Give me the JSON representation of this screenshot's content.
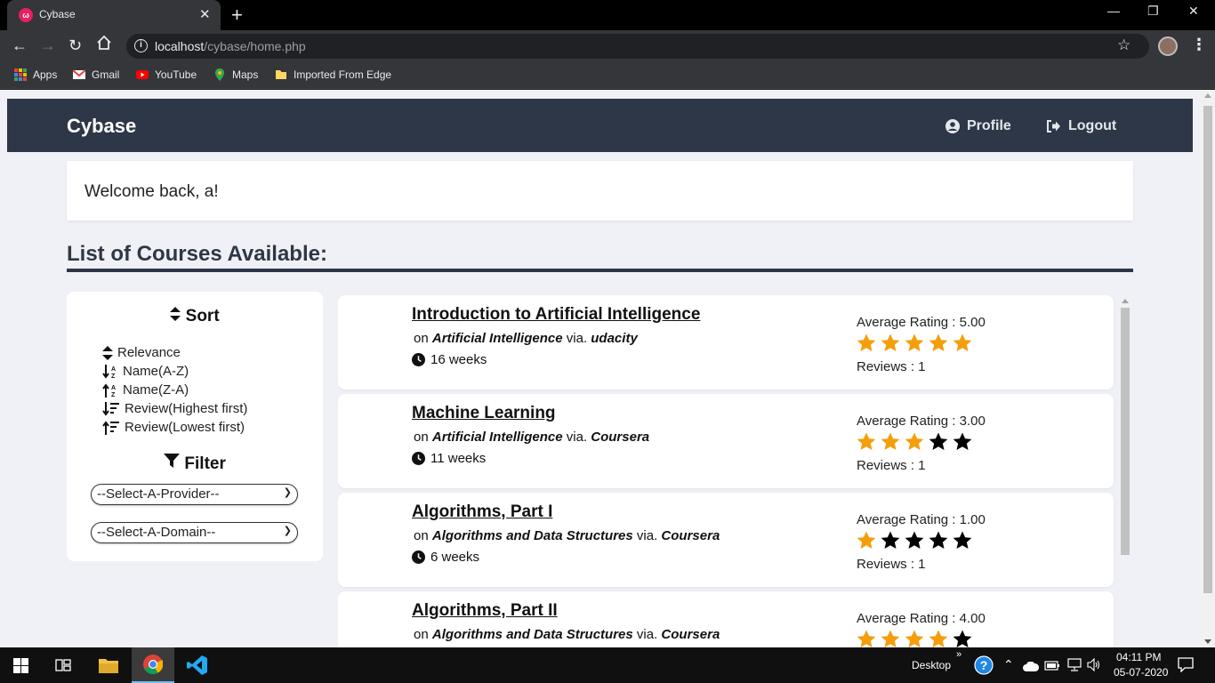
{
  "browser": {
    "tab_title": "Cybase",
    "tab_icon_letter": "ω",
    "url_host": "localhost",
    "url_path": "/cybase/home.php",
    "bookmarks": [
      "Apps",
      "Gmail",
      "YouTube",
      "Maps",
      "Imported From Edge"
    ]
  },
  "navbar": {
    "brand": "Cybase",
    "profile_label": "Profile",
    "logout_label": "Logout"
  },
  "welcome": "Welcome back, a!",
  "list_heading": "List of Courses Available:",
  "sidebar": {
    "sort_title": "Sort",
    "sort_options": [
      "Relevance",
      "Name(A-Z)",
      "Name(Z-A)",
      "Review(Highest first)",
      "Review(Lowest first)"
    ],
    "filter_title": "Filter",
    "provider_select": "--Select-A-Provider--",
    "domain_select": "--Select-A-Domain--"
  },
  "courses": [
    {
      "title": "Introduction to Artificial Intelligence",
      "on": "on",
      "domain": "Artificial Intelligence",
      "via": "via.",
      "provider": "udacity",
      "duration": "16 weeks",
      "rating_label": "Average Rating : 5.00",
      "rating": 5,
      "reviews": "Reviews : 1"
    },
    {
      "title": "Machine Learning",
      "on": "on",
      "domain": "Artificial Intelligence",
      "via": "via.",
      "provider": "Coursera",
      "duration": "11 weeks",
      "rating_label": "Average Rating : 3.00",
      "rating": 3,
      "reviews": "Reviews : 1"
    },
    {
      "title": "Algorithms, Part I",
      "on": "on",
      "domain": "Algorithms and Data Structures",
      "via": "via.",
      "provider": "Coursera",
      "duration": "6 weeks",
      "rating_label": "Average Rating : 1.00",
      "rating": 1,
      "reviews": "Reviews : 1"
    },
    {
      "title": "Algorithms, Part II",
      "on": "on",
      "domain": "Algorithms and Data Structures",
      "via": "via.",
      "provider": "Coursera",
      "duration": "",
      "rating_label": "Average Rating : 4.00",
      "rating": 4,
      "reviews": ""
    }
  ],
  "colors": {
    "star_filled": "#f59e0b",
    "star_empty": "#000000",
    "navbar_bg": "#2e3748"
  },
  "taskbar": {
    "desktop_label": "Desktop",
    "time": "04:11 PM",
    "date": "05-07-2020"
  }
}
